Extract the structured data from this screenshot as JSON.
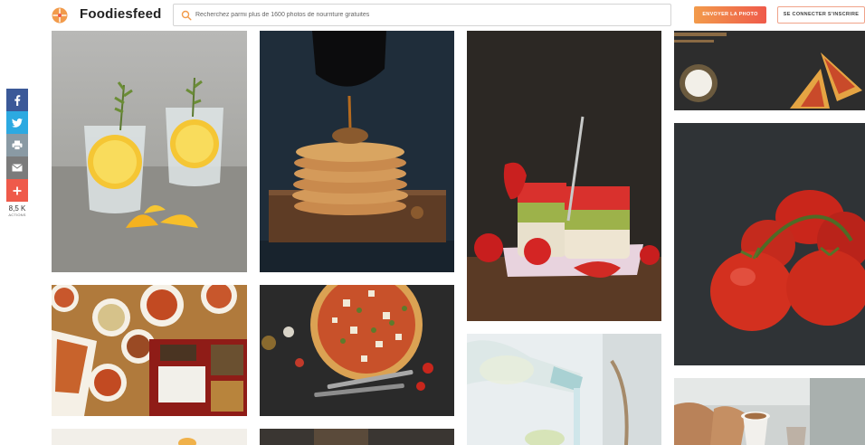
{
  "header": {
    "logo_text": "Foodiesfeed",
    "search_placeholder": "Recherchez parmi plus de 1600 photos de nourriture gratuites",
    "upload_label": "ENVOYER LA PHOTO",
    "signup_label": "SE CONNECTER S'INSCRIRE"
  },
  "share": {
    "count": "8,5 K",
    "label": "ACTIONS",
    "buttons": [
      "facebook-icon",
      "twitter-icon",
      "print-icon",
      "email-icon",
      "plus-icon"
    ]
  },
  "colors": {
    "accent_orange": "#f29b4b",
    "accent_red": "#ef5a4a",
    "facebook": "#3b5998",
    "twitter": "#2ca9e1"
  },
  "photos": [
    {
      "subject": "lemon-water-glasses"
    },
    {
      "subject": "pancake-stack-syrup"
    },
    {
      "subject": "strawberry-kiwi-parfaits"
    },
    {
      "subject": "pizza-slices-board"
    },
    {
      "subject": "red-tomatoes"
    },
    {
      "subject": "asian-dishes-table"
    },
    {
      "subject": "pizza-knife-fork"
    },
    {
      "subject": "water-pouring-glass"
    },
    {
      "subject": "coffee-cup-hand"
    }
  ]
}
